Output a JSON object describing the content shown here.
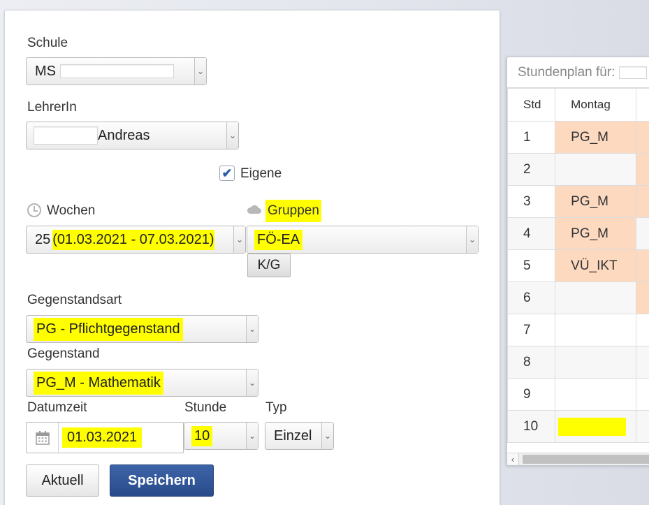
{
  "form": {
    "schule": {
      "label": "Schule",
      "value": "MS"
    },
    "lehrerin": {
      "label": "LehrerIn",
      "value": "Andreas"
    },
    "eigene": {
      "label": "Eigene",
      "checked": true
    },
    "wochen": {
      "label": "Wochen",
      "week_num": "25",
      "range": "(01.03.2021 - 07.03.2021)"
    },
    "gruppen": {
      "label": "Gruppen",
      "value": "FÖ-EA",
      "kg_button": "K/G"
    },
    "gegenstandsart": {
      "label": "Gegenstandsart",
      "value": "PG - Pflichtgegenstand"
    },
    "gegenstand": {
      "label": "Gegenstand",
      "value": "PG_M - Mathematik"
    },
    "datumzeit": {
      "label": "Datumzeit",
      "value": "01.03.2021"
    },
    "stunde": {
      "label": "Stunde",
      "value": "10"
    },
    "typ": {
      "label": "Typ",
      "value": "Einzel"
    },
    "buttons": {
      "aktuell": "Aktuell",
      "speichern": "Speichern"
    }
  },
  "schedule": {
    "title": "Stundenplan für:",
    "columns": [
      "Std",
      "Montag"
    ],
    "rows": [
      {
        "std": "1",
        "montag": "PG_M"
      },
      {
        "std": "2",
        "montag": ""
      },
      {
        "std": "3",
        "montag": "PG_M"
      },
      {
        "std": "4",
        "montag": "PG_M"
      },
      {
        "std": "5",
        "montag": "VÜ_IKT"
      },
      {
        "std": "6",
        "montag": ""
      },
      {
        "std": "7",
        "montag": ""
      },
      {
        "std": "8",
        "montag": ""
      },
      {
        "std": "9",
        "montag": ""
      },
      {
        "std": "10",
        "montag": ""
      }
    ]
  },
  "icons": {
    "dropdown": "chevron-down-icon",
    "check": "checkmark-icon",
    "clock": "clock-icon",
    "cloud": "cloud-icon",
    "calendar": "calendar-icon",
    "scroll_left": "chevron-left-icon"
  },
  "colors": {
    "highlight": "#ffff00",
    "lesson": "#fdd9c0",
    "primary": "#2f5597"
  }
}
